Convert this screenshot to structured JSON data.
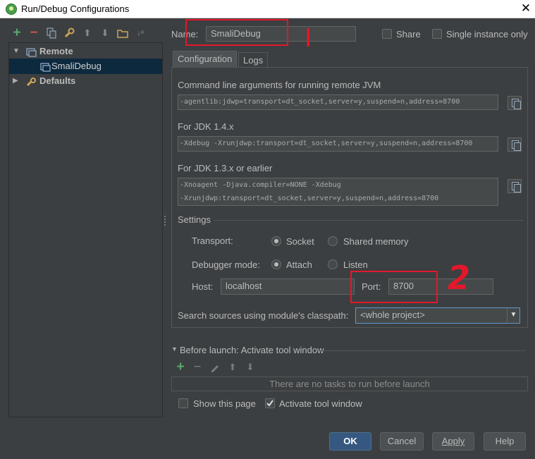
{
  "window": {
    "title": "Run/Debug Configurations",
    "close_glyph": "✕"
  },
  "tree_toolbar": {
    "icons": [
      "add-icon",
      "remove-icon",
      "copy-icon",
      "wrench-icon",
      "move-up-icon",
      "move-down-icon",
      "folder-icon",
      "sort-icon"
    ],
    "glyphs": {
      "add": "+",
      "remove": "−",
      "up": "⬆",
      "down": "⬇",
      "sort": "↓ᵃ"
    }
  },
  "tree": {
    "remote_label": "Remote",
    "smali_label": "SmaliDebug",
    "defaults_label": "Defaults"
  },
  "name_row": {
    "label": "Name:",
    "value": "SmaliDebug",
    "share_label": "Share",
    "single_instance_label": "Single instance only"
  },
  "tabs": {
    "configuration": "Configuration",
    "logs": "Logs"
  },
  "config": {
    "cmdline_label": "Command line arguments for running remote JVM",
    "cmdline_value": "-agentlib:jdwp=transport=dt_socket,server=y,suspend=n,address=8700",
    "jdk14_label": "For JDK 1.4.x",
    "jdk14_value": "-Xdebug -Xrunjdwp:transport=dt_socket,server=y,suspend=n,address=8700",
    "jdk13_label": "For JDK 1.3.x or earlier",
    "jdk13_line1": "-Xnoagent -Djava.compiler=NONE -Xdebug",
    "jdk13_line2": "-Xrunjdwp:transport=dt_socket,server=y,suspend=n,address=8700",
    "settings_label": "Settings",
    "transport_label": "Transport:",
    "socket_label": "Socket",
    "shared_memory_label": "Shared memory",
    "transport_selected": "Socket",
    "debugger_mode_label": "Debugger mode:",
    "attach_label": "Attach",
    "listen_label": "Listen",
    "debugger_mode_selected": "Attach",
    "host_label": "Host:",
    "host_value": "localhost",
    "port_label": "Port:",
    "port_value": "8700",
    "search_sources_label": "Search sources using module's classpath:",
    "search_sources_value": "<whole project>"
  },
  "before_launch": {
    "label": "Before launch: Activate tool window",
    "empty_text": "There are no tasks to run before launch",
    "show_page_label": "Show this page",
    "show_page_checked": false,
    "activate_label": "Activate tool window",
    "activate_checked": true
  },
  "buttons": {
    "ok": "OK",
    "cancel": "Cancel",
    "apply": "Apply",
    "help": "Help"
  },
  "annotations": {
    "mark1": "I",
    "mark2": "2"
  },
  "colors": {
    "accent": "#365880",
    "annotation": "#e2182b",
    "selection": "#0d293e",
    "add_green": "#59a869",
    "remove_red": "#c75450"
  }
}
